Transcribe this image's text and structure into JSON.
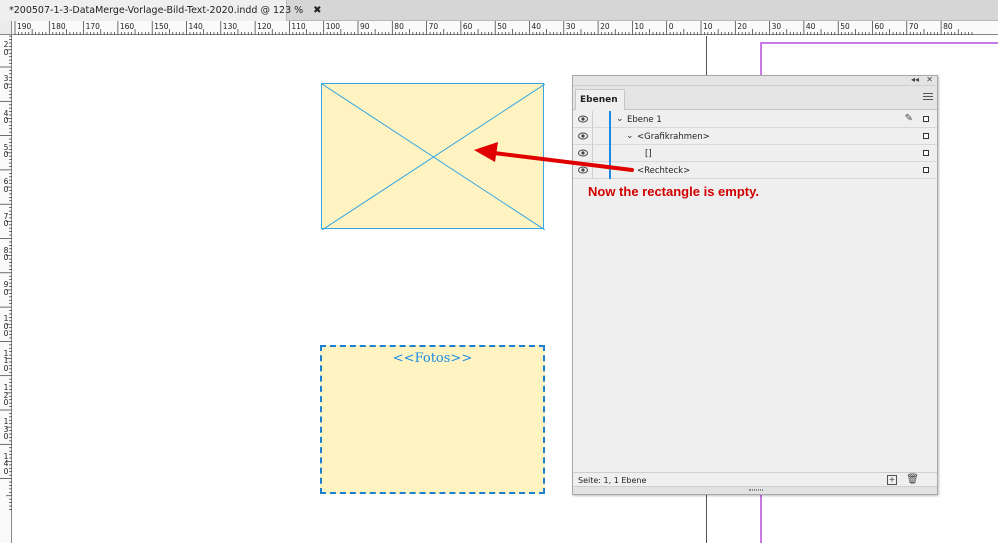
{
  "document_tab": {
    "title": "*200507-1-3-DataMerge-Vorlage-Bild-Text-2020.indd @ 123 %",
    "close": "✖"
  },
  "ruler": {
    "horizontal": [
      "190",
      "180",
      "170",
      "160",
      "150",
      "140",
      "130",
      "120",
      "110",
      "100",
      "90",
      "80",
      "70",
      "60",
      "50",
      "40",
      "30",
      "20",
      "10",
      "0",
      "10",
      "20",
      "30",
      "40",
      "50",
      "60",
      "70",
      "80"
    ],
    "vertical": [
      "2 0",
      "3 0",
      "4 0",
      "5 0",
      "6 0",
      "7 0",
      "8 0",
      "9 0",
      "1 0 0",
      "1 1 0",
      "1 2 0",
      "1 3 0",
      "1 4 0"
    ]
  },
  "canvas": {
    "fotos_placeholder": "<<Fotos>>",
    "annotation": "Now the rectangle is empty.",
    "colors": {
      "frame_fill": "#fff4c1",
      "frame_stroke": "#37a6e3",
      "arrow": "#e00000",
      "page_edge": "#c879e3"
    }
  },
  "layers_panel": {
    "top_controls": {
      "collapse": "◂◂",
      "close": "✕"
    },
    "tab_label": "Ebenen",
    "rows": [
      {
        "name": "Ebene 1",
        "level": 0,
        "expanded": true,
        "pen": "✎"
      },
      {
        "name": "<Grafikrahmen>",
        "level": 1,
        "expanded": true
      },
      {
        "name": "[]",
        "level": 2
      },
      {
        "name": "<Rechteck>",
        "level": 1
      }
    ],
    "status": "Seite: 1, 1 Ebene",
    "new_layer_icon": "+",
    "trash_icon": "🗑"
  }
}
